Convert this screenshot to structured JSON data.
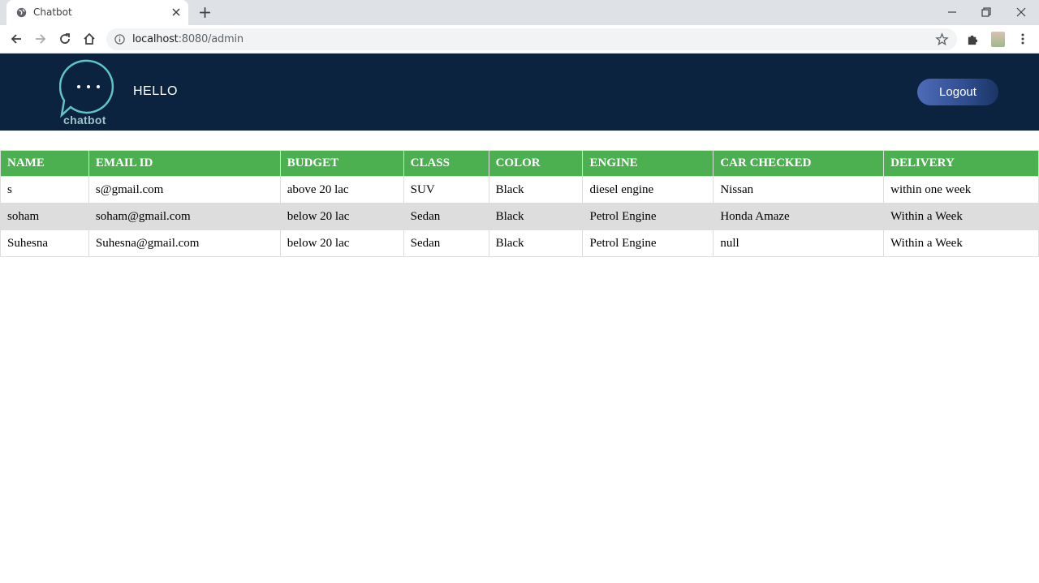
{
  "browser": {
    "tab_title": "Chatbot",
    "url_host": "localhost",
    "url_rest": ":8080/admin"
  },
  "header": {
    "logo_text": "chatbot",
    "greeting": "HELLO",
    "logout_label": "Logout",
    "bg_color": "#0c2340"
  },
  "table": {
    "header_color": "#4caf50",
    "columns": [
      "NAME",
      "EMAIL ID",
      "BUDGET",
      "CLASS",
      "COLOR",
      "ENGINE",
      "CAR CHECKED",
      "DELIVERY"
    ],
    "rows": [
      [
        "s",
        "s@gmail.com",
        "above 20 lac",
        "SUV",
        "Black",
        "diesel engine",
        "Nissan",
        "within one week"
      ],
      [
        "soham",
        "soham@gmail.com",
        "below 20 lac",
        "Sedan",
        "Black",
        "Petrol Engine",
        "Honda Amaze",
        "Within a Week"
      ],
      [
        "Suhesna",
        "Suhesna@gmail.com",
        "below 20 lac",
        "Sedan",
        "Black",
        "Petrol Engine",
        "null",
        "Within a Week"
      ]
    ]
  }
}
